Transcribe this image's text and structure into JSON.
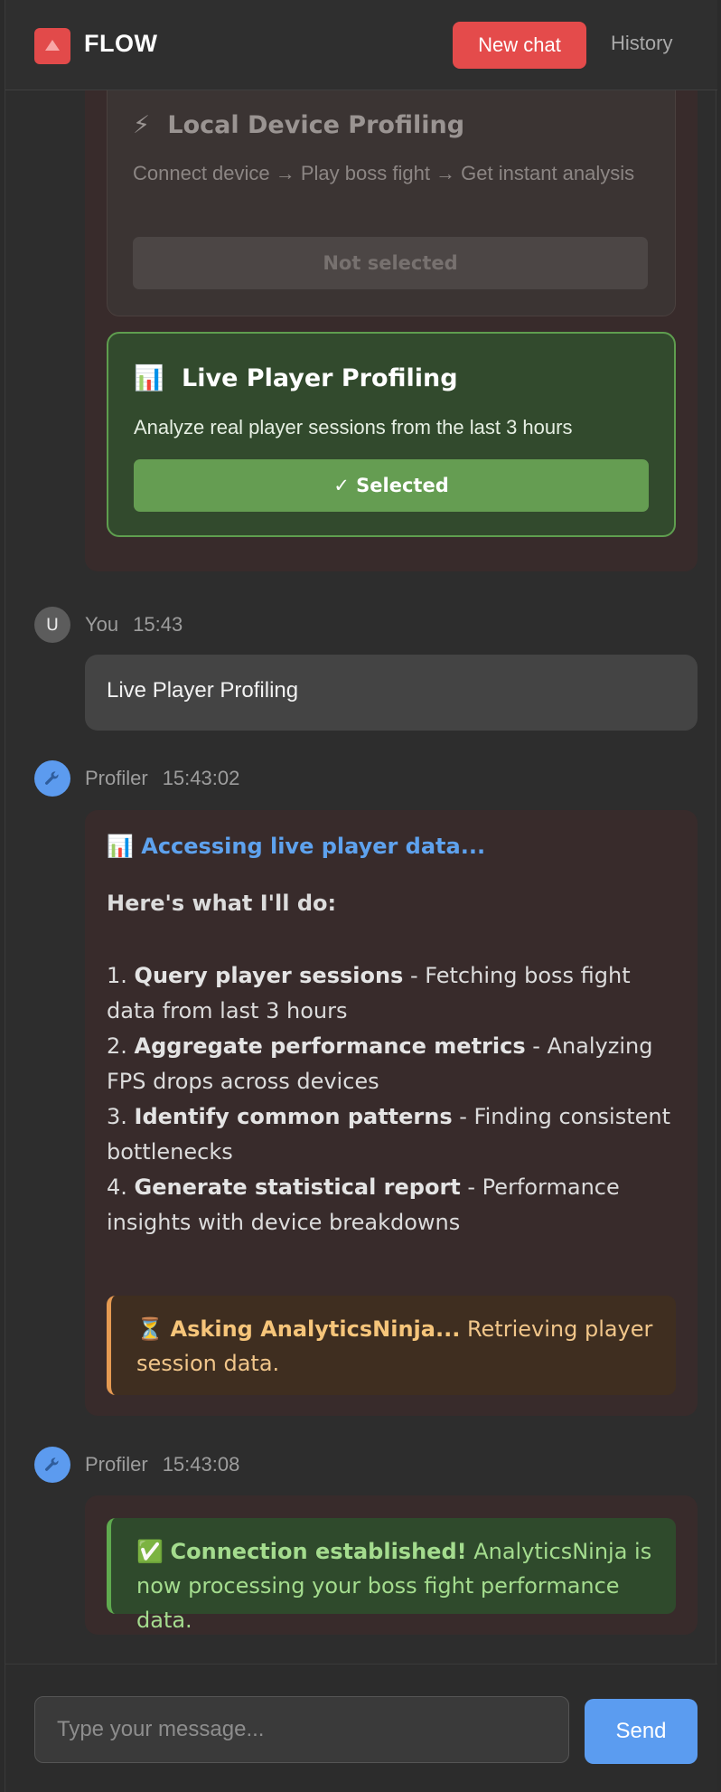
{
  "header": {
    "brand": "FLOW",
    "new_chat_label": "New chat",
    "history_label": "History"
  },
  "options": {
    "local": {
      "icon": "⚡",
      "title": "Local Device Profiling",
      "description": "Connect device → Play boss fight → Get instant analysis",
      "button_label": "Not selected"
    },
    "live": {
      "icon": "📊",
      "title": "Live Player Profiling",
      "description": "Analyze real player sessions from the last 3 hours",
      "button_label": "✓ Selected"
    }
  },
  "messages": {
    "user": {
      "avatar": "U",
      "name": "You",
      "time": "15:43",
      "text": "Live Player Profiling"
    },
    "profiler1": {
      "avatar_icon": "wrench-icon",
      "name": "Profiler",
      "time": "15:43:02",
      "heading_icon": "📊",
      "heading": "Accessing live player data...",
      "plan_title": "Here's what I'll do:",
      "steps": [
        {
          "num": "1.",
          "bold": "Query player sessions",
          "rest": " - Fetching boss fight data from last 3 hours"
        },
        {
          "num": "2.",
          "bold": "Aggregate performance metrics",
          "rest": " - Analyzing FPS drops across devices"
        },
        {
          "num": "3.",
          "bold": "Identify common patterns",
          "rest": " - Finding consistent bottlenecks"
        },
        {
          "num": "4.",
          "bold": "Generate statistical report",
          "rest": " - Performance insights with device breakdowns"
        }
      ],
      "status_icon": "⏳",
      "status_bold": "Asking AnalyticsNinja...",
      "status_text": " Retrieving player session data."
    },
    "profiler2": {
      "avatar_icon": "wrench-icon",
      "name": "Profiler",
      "time": "15:43:08",
      "status_icon": "✅",
      "status_bold": "Connection established!",
      "status_text": " AnalyticsNinja is now processing your boss fight performance data."
    }
  },
  "composer": {
    "placeholder": "Type your message...",
    "send_label": "Send"
  },
  "colors": {
    "accent_red": "#e44b4b",
    "accent_blue": "#5b9cf0",
    "selected_green": "#5f9e4f",
    "warning_orange": "#e59a52"
  }
}
